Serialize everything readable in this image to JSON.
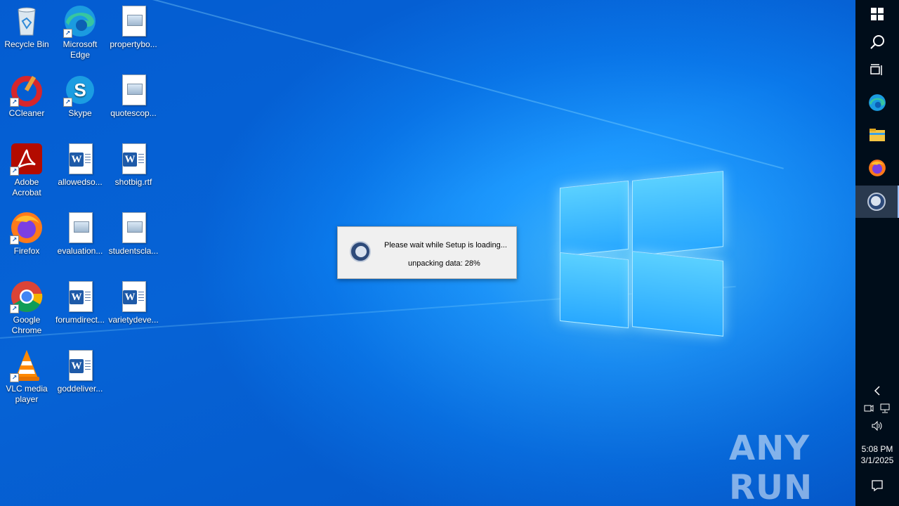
{
  "desktop": {
    "icons": [
      {
        "label": "Recycle Bin",
        "icon": "recycle-bin-icon"
      },
      {
        "label": "Microsoft Edge",
        "icon": "edge-icon"
      },
      {
        "label": "propertybo...",
        "icon": "image-file-icon"
      },
      {
        "label": "CCleaner",
        "icon": "ccleaner-icon"
      },
      {
        "label": "Skype",
        "icon": "skype-icon"
      },
      {
        "label": "quotescop...",
        "icon": "image-file-icon"
      },
      {
        "label": "Adobe Acrobat",
        "icon": "acrobat-icon"
      },
      {
        "label": "allowedso...",
        "icon": "word-doc-icon"
      },
      {
        "label": "shotbig.rtf",
        "icon": "word-doc-icon"
      },
      {
        "label": "Firefox",
        "icon": "firefox-icon"
      },
      {
        "label": "evaluation...",
        "icon": "image-file-icon"
      },
      {
        "label": "studentscla...",
        "icon": "image-file-icon"
      },
      {
        "label": "Google Chrome",
        "icon": "chrome-icon"
      },
      {
        "label": "forumdirect...",
        "icon": "word-doc-icon"
      },
      {
        "label": "varietydeve...",
        "icon": "word-doc-icon"
      },
      {
        "label": "VLC media player",
        "icon": "vlc-icon"
      },
      {
        "label": "goddeliver...",
        "icon": "word-doc-icon"
      }
    ]
  },
  "dialog": {
    "message": "Please wait while Setup is loading...",
    "progress": "unpacking data: 28%",
    "progress_value": 28
  },
  "taskbar": {
    "time": "5:08 PM",
    "date": "3/1/2025"
  },
  "watermark": {
    "text": "ANY RUN"
  },
  "colors": {
    "accent": "#0a78ea",
    "taskbar": "#000d1a"
  }
}
